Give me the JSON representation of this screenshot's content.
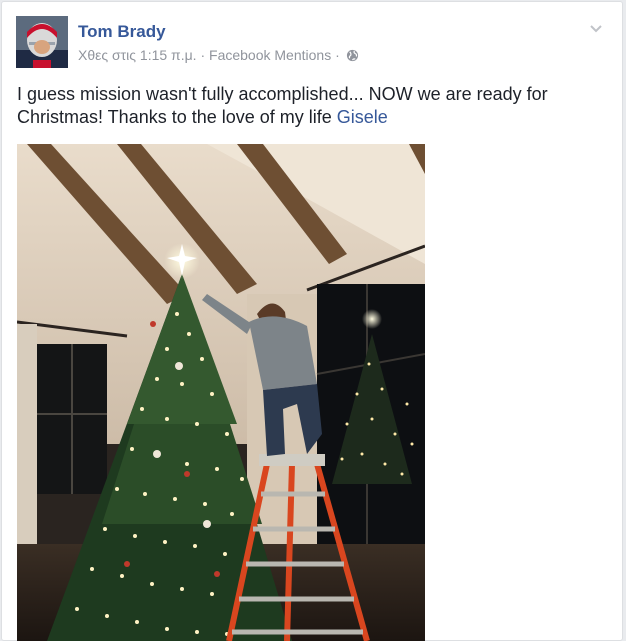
{
  "post": {
    "author": "Tom Brady",
    "timestamp": "Χθες στις 1:15 π.μ.",
    "separator1": " · ",
    "source": "Facebook Mentions",
    "separator2": " · ",
    "audience_icon": "globe-icon",
    "body_text": "I guess mission wasn't fully accomplished... NOW we are ready for Christmas! Thanks to the love of my life ",
    "tagged_name": "Gisele",
    "menu_icon": "chevron-down-icon"
  },
  "colors": {
    "name_link": "#365899",
    "meta_text": "#90949c",
    "body_text": "#1d2129"
  }
}
